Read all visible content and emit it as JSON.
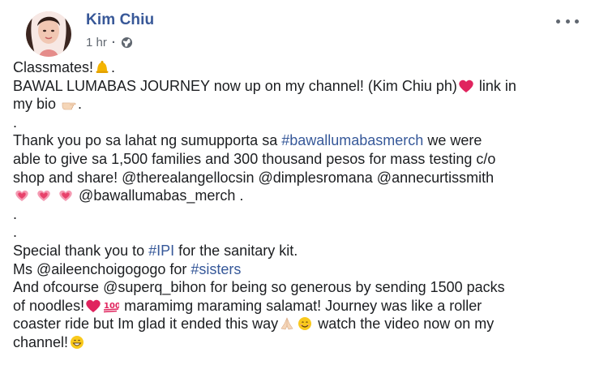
{
  "post": {
    "author": "Kim Chiu",
    "time": "1 hr",
    "separator": "·",
    "privacy_icon": "globe-icon",
    "more_icon": "more-options-icon"
  },
  "content": {
    "line1": {
      "text": "Classmates!",
      "emoji_after": "bell-emoji",
      "end": "."
    },
    "line2": {
      "text": "BAWAL LUMABAS JOURNEY now up on my channel! (Kim Chiu ph)",
      "emoji_after": "red-heart-emoji",
      "end": " link in"
    },
    "line3": {
      "text": "my bio ",
      "emoji_after": "pointing-hand-emoji",
      "end": "."
    },
    "line4": ".",
    "line5_a": "Thank you po sa lahat ng sumupporta sa ",
    "line5_tag": "#bawallumabasmerch",
    "line5_b": " we were",
    "line6": "able to give sa 1,500 families and 300 thousand pesos for mass testing c/o",
    "line7": "shop and share! @therealangellocsin @dimplesromana @annecurtissmith",
    "line8": "@bawallumabas_merch .",
    "line9": ".",
    "line10": ".",
    "line11_a": "Special thank you to ",
    "line11_tag": "#IPI",
    "line11_b": " for the sanitary kit.",
    "line12_a": "Ms @aileenchoigogogo for ",
    "line12_tag": "#sisters",
    "line13": "And ofcourse @superq_bihon for being so generous by sending 1500 packs",
    "line14_a": "of noodles!",
    "line14_b": " maramimg maraming salamat! Journey was like a roller",
    "line15": "coaster ride but Im glad it ended this way",
    "line15_b": " watch the video now on my",
    "line16": "channel!"
  },
  "colors": {
    "author": "#385898",
    "hashtag": "#365899",
    "text": "#1c1e21",
    "meta": "#606770",
    "heart": "#e0245e"
  }
}
